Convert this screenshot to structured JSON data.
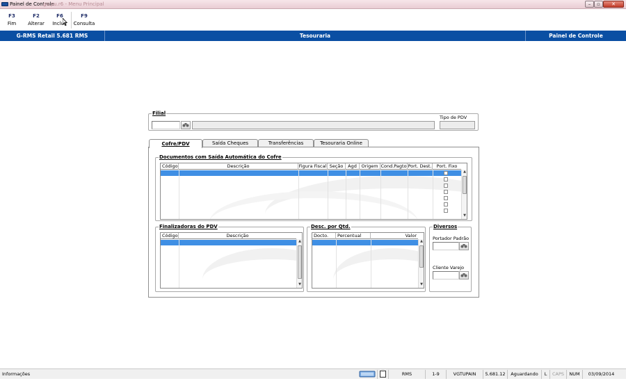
{
  "window": {
    "title": "Painel de Controle",
    "ghost_title": "go.pu.r6 - Menu Principal",
    "minimize_glyph": "–",
    "maximize_glyph": "▫",
    "close_glyph": "✕"
  },
  "toolbar": {
    "buttons": [
      {
        "key": "F3",
        "label": "Fim"
      },
      {
        "key": "F2",
        "label": "Alterar"
      },
      {
        "key": "F6",
        "label": "Incluir"
      },
      {
        "key": "F9",
        "label": "Consulta"
      }
    ]
  },
  "header": {
    "version": "G-RMS Retail 5.681 RMS",
    "module": "Tesouraria",
    "screen": "Painel de Controle"
  },
  "filial": {
    "label": "Filial",
    "code_value": "",
    "name_value": "",
    "tipo_pdv_label": "Tipo de PDV",
    "tipo_pdv_value": ""
  },
  "tabs": [
    {
      "label": "Cofre/PDV",
      "active": true
    },
    {
      "label": "Saída Cheques",
      "active": false
    },
    {
      "label": "Transferências",
      "active": false
    },
    {
      "label": "Tesouraria Online",
      "active": false
    }
  ],
  "documentos": {
    "title": "Documentos com Saída Automática do Cofre",
    "columns": [
      "Código",
      "Descrição",
      "Figura Fiscal",
      "Seção",
      "Agd",
      "Origem",
      "Cond.Pagto",
      "Port. Dest.",
      "Port. Fixo"
    ],
    "rows": []
  },
  "finalizadoras": {
    "title": "Finalizadoras do PDV",
    "columns": [
      "Código",
      "Descrição"
    ],
    "rows": []
  },
  "desconto": {
    "title": "Desc. por Qtd.",
    "columns": [
      "Docto.",
      "Percentual",
      "Valor"
    ],
    "rows": []
  },
  "diversos": {
    "title": "Diversos",
    "portador_label": "Portador Padrão",
    "portador_value": "",
    "cliente_label": "Cliente Varejo",
    "cliente_value": ""
  },
  "statusbar": {
    "message": "Informações",
    "system": "RMS",
    "range": "1-9",
    "program": "VGTUPAIN",
    "version": "5.681.12",
    "state": "Aguardando",
    "lock_l": "L",
    "caps": "CAPS",
    "num": "NUM",
    "date": "03/09/2014"
  },
  "icons": {
    "search": "binoculars-icon",
    "app": "app-logo-icon"
  },
  "colors": {
    "header_blue": "#0a4fa3",
    "selection_blue": "#3f8fe4",
    "close_red": "#c23c2a"
  }
}
